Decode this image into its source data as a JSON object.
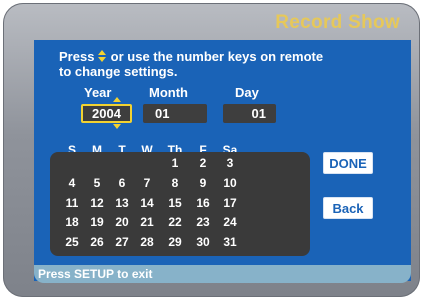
{
  "screen": {
    "title": "Record Show"
  },
  "instructions": {
    "line1_prefix": "Press",
    "line1_suffix": "or use the number keys on remote",
    "line2": "to change settings."
  },
  "date": {
    "year_label": "Year",
    "month_label": "Month",
    "day_label": "Day",
    "year_value": "2004",
    "month_value": "01",
    "day_value": "01"
  },
  "calendar": {
    "weekdays": [
      "S",
      "M",
      "T",
      "W",
      "Th",
      "F",
      "Sa"
    ],
    "weeks": [
      [
        "",
        "",
        "",
        "",
        "1",
        "2",
        "3"
      ],
      [
        "4",
        "5",
        "6",
        "7",
        "8",
        "9",
        "10"
      ],
      [
        "11",
        "12",
        "13",
        "14",
        "15",
        "16",
        "17"
      ],
      [
        "18",
        "19",
        "20",
        "21",
        "22",
        "23",
        "24"
      ],
      [
        "25",
        "26",
        "27",
        "28",
        "29",
        "30",
        "31"
      ]
    ]
  },
  "buttons": {
    "done": "DONE",
    "back": "Back"
  },
  "status": {
    "text": "Press SETUP to exit"
  },
  "colors": {
    "accent_yellow": "#f2d231",
    "title_gold": "#e6c85a",
    "panel_blue": "#1a63b7",
    "status_bar": "#87b2c9"
  }
}
